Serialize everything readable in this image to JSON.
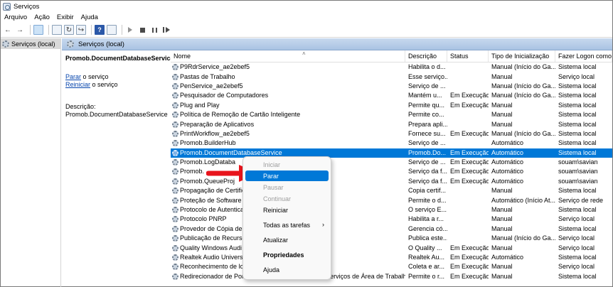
{
  "window": {
    "title": "Serviços"
  },
  "menu": [
    "Arquivo",
    "Ação",
    "Exibir",
    "Ajuda"
  ],
  "tree": {
    "root_label": "Serviços (local)"
  },
  "header_band": {
    "label": "Serviços (local)"
  },
  "details": {
    "service_name": "Promob.DocumentDatabaseService",
    "stop_link": "Parar",
    "stop_suffix": " o serviço",
    "restart_link": "Reiniciar",
    "restart_suffix": " o serviço",
    "description_label": "Descrição:",
    "description_value": "Promob.DocumentDatabaseService"
  },
  "columns": {
    "name": "Nome",
    "description": "Descrição",
    "status": "Status",
    "startup": "Tipo de Inicialização",
    "logon": "Fazer Logon como"
  },
  "rows": [
    {
      "name": "P9RdrService_ae2ebef5",
      "desc": "Habilita o d...",
      "status": "",
      "start": "Manual (Início do Ga...",
      "logon": "Sistema local"
    },
    {
      "name": "Pastas de Trabalho",
      "desc": "Esse serviço...",
      "status": "",
      "start": "Manual",
      "logon": "Serviço local"
    },
    {
      "name": "PenService_ae2ebef5",
      "desc": "Serviço de ...",
      "status": "",
      "start": "Manual (Início do Ga...",
      "logon": "Sistema local"
    },
    {
      "name": "Pesquisador de Computadores",
      "desc": "Mantém u...",
      "status": "Em Execução",
      "start": "Manual (Início do Ga...",
      "logon": "Sistema local"
    },
    {
      "name": "Plug and Play",
      "desc": "Permite qu...",
      "status": "Em Execução",
      "start": "Manual",
      "logon": "Sistema local"
    },
    {
      "name": "Política de Remoção de Cartão Inteligente",
      "desc": "Permite co...",
      "status": "",
      "start": "Manual",
      "logon": "Sistema local"
    },
    {
      "name": "Preparação de Aplicativos",
      "desc": "Prepara apli...",
      "status": "",
      "start": "Manual",
      "logon": "Sistema local"
    },
    {
      "name": "PrintWorkflow_ae2ebef5",
      "desc": "Fornece su...",
      "status": "Em Execução",
      "start": "Manual (Início do Ga...",
      "logon": "Sistema local"
    },
    {
      "name": "Promob.BuilderHub",
      "desc": "Serviço de ...",
      "status": "",
      "start": "Automático",
      "logon": "Sistema local"
    },
    {
      "name": "Promob.DocumentDatabaseService",
      "desc": "Promob.Do...",
      "status": "Em Execução",
      "start": "Automático",
      "logon": "Sistema local",
      "selected": true
    },
    {
      "name": "Promob.LogDataba",
      "desc": "Serviço de ...",
      "status": "Em Execução",
      "start": "Automático",
      "logon": "souam\\savian"
    },
    {
      "name": "Promob.",
      "desc": "Serviço da f...",
      "status": "Em Execução",
      "start": "Automático",
      "logon": "souam\\savian"
    },
    {
      "name": "Promob.QueueProj",
      "desc": "Serviço da f...",
      "status": "Em Execução",
      "start": "Automático",
      "logon": "souam\\savian"
    },
    {
      "name": "Propagação de Certific",
      "desc": "Copia certif...",
      "status": "",
      "start": "Manual",
      "logon": "Sistema local"
    },
    {
      "name": "Proteção de Software",
      "desc": "Permite o d...",
      "status": "",
      "start": "Automático (Início At...",
      "logon": "Serviço de rede"
    },
    {
      "name": "Protocolo de Autentica",
      "desc": "O serviço E...",
      "status": "",
      "start": "Manual",
      "logon": "Sistema local"
    },
    {
      "name": "Protocolo PNRP",
      "desc": "Habilita a r...",
      "status": "",
      "start": "Manual",
      "logon": "Serviço local"
    },
    {
      "name": "Provedor de Cópia de S",
      "desc": "Gerencia có...",
      "status": "",
      "start": "Manual",
      "logon": "Sistema local"
    },
    {
      "name": "Publicação de Recurso",
      "desc": "Publica este...",
      "status": "",
      "start": "Manual (Início do Ga...",
      "logon": "Serviço local"
    },
    {
      "name": "Quality Windows Audi",
      "desc": "O Quality ...",
      "status": "Em Execução",
      "start": "Manual",
      "logon": "Serviço local"
    },
    {
      "name": "Realtek Audio Universa",
      "desc": "Realtek Au...",
      "status": "Em Execução",
      "start": "Automático",
      "logon": "Sistema local"
    },
    {
      "name": "Reconhecimento de lo",
      "desc": "Coleta e ar...",
      "status": "Em Execução",
      "start": "Manual",
      "logon": "Serviço local"
    },
    {
      "name": "Redirecionador de Portas do Modo do Usuário dos Serviços de Área de Trabalho",
      "desc": "Permite o r...",
      "status": "Em Execução",
      "start": "Manual",
      "logon": "Sistema local"
    }
  ],
  "context_menu": {
    "iniciar": "Iniciar",
    "parar": "Parar",
    "pausar": "Pausar",
    "continuar": "Continuar",
    "reiniciar": "Reiniciar",
    "todas_tarefas": "Todas as tarefas",
    "atualizar": "Atualizar",
    "propriedades": "Propriedades",
    "ajuda": "Ajuda"
  },
  "colors": {
    "selection": "#0078d7",
    "arrow": "#e8141c",
    "link": "#0645ad"
  }
}
